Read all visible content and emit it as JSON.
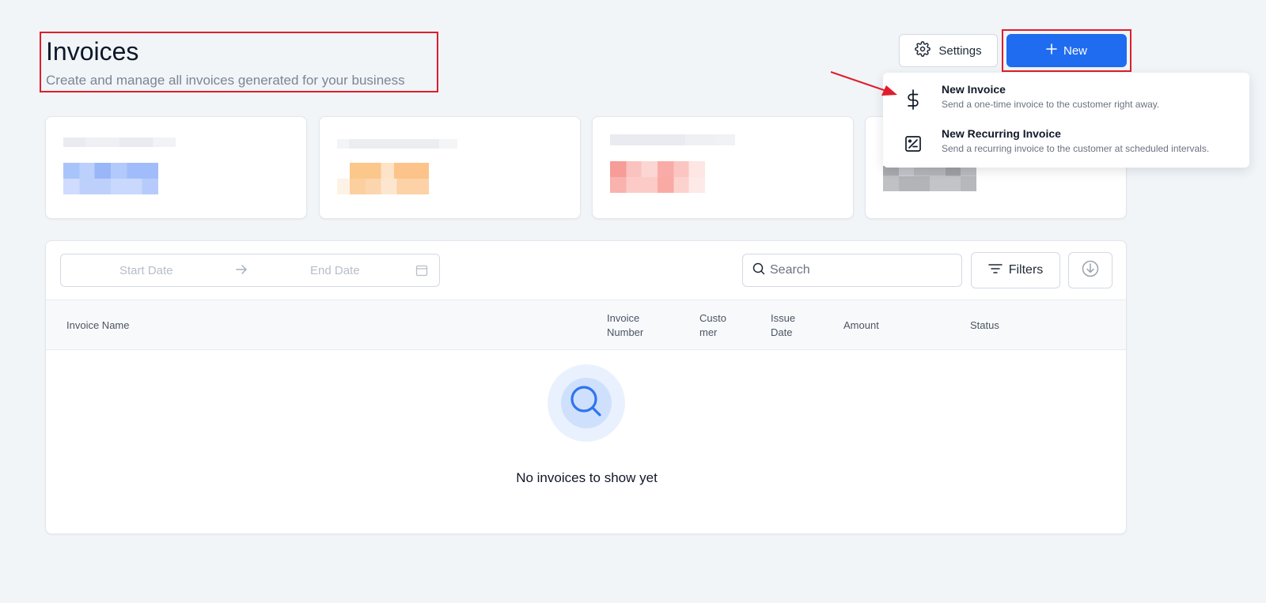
{
  "header": {
    "title": "Invoices",
    "subtitle": "Create and manage all invoices generated for your business"
  },
  "actions": {
    "settings_label": "Settings",
    "settings_icon": "gear-icon",
    "new_label": "New",
    "new_icon": "plus-icon"
  },
  "dropdown": {
    "items": [
      {
        "title": "New Invoice",
        "description": "Send a one-time invoice to the customer right away.",
        "icon": "dollar-icon"
      },
      {
        "title": "New Recurring Invoice",
        "description": "Send a recurring invoice to the customer at scheduled intervals.",
        "icon": "recurring-invoice-icon"
      }
    ]
  },
  "summary_cards": [
    {
      "accent": "#c4d6fb",
      "state": "pixelated"
    },
    {
      "accent": "#fcd1a0",
      "state": "pixelated"
    },
    {
      "accent": "#f9b9b5",
      "state": "pixelated"
    },
    {
      "accent": "#b9bcc2",
      "state": "pixelated"
    }
  ],
  "toolbar": {
    "start_date_placeholder": "Start Date",
    "end_date_placeholder": "End Date",
    "search_placeholder": "Search",
    "filters_label": "Filters"
  },
  "table": {
    "columns": [
      "Invoice Name",
      "Invoice\nNumber",
      "Custo\nmer",
      "Issue\nDate",
      "Amount",
      "Status"
    ],
    "rows": []
  },
  "empty_state": {
    "message": "No invoices to show yet"
  },
  "colors": {
    "primary": "#1f6cf0",
    "highlight": "#e11d2b",
    "background": "#f1f5f8"
  }
}
